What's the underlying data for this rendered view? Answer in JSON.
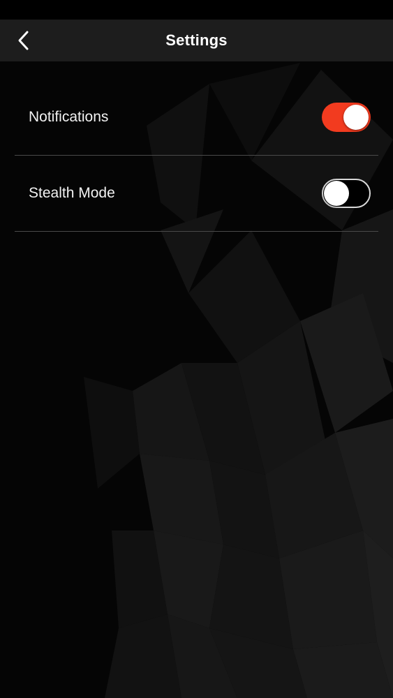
{
  "header": {
    "title": "Settings",
    "back_icon": "chevron-left-icon"
  },
  "settings": {
    "items": [
      {
        "label": "Notifications",
        "enabled": true
      },
      {
        "label": "Stealth Mode",
        "enabled": false
      }
    ]
  },
  "colors": {
    "background": "#050505",
    "navbar": "#1d1d1d",
    "toggle_on": "#f23b1f",
    "toggle_off_border": "#d9d9d9",
    "divider": "#4a4a4a"
  }
}
